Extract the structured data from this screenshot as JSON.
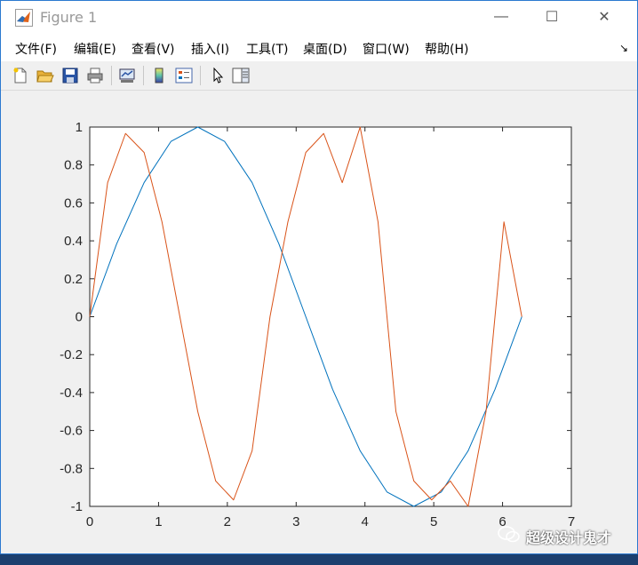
{
  "window": {
    "title": "Figure 1",
    "minimize_glyph": "—",
    "maximize_glyph": "☐",
    "close_glyph": "✕"
  },
  "menu": {
    "items": [
      "文件(F)",
      "编辑(E)",
      "查看(V)",
      "插入(I)",
      "工具(T)",
      "桌面(D)",
      "窗口(W)",
      "帮助(H)"
    ],
    "dock_glyph": "↘"
  },
  "toolbar": {
    "icons": [
      "new-figure-icon",
      "open-file-icon",
      "save-icon",
      "print-icon",
      "link-plot-icon",
      "colorbar-icon",
      "legend-icon",
      "pointer-icon",
      "property-inspector-icon"
    ]
  },
  "chart_data": {
    "type": "line",
    "title": "",
    "xlabel": "",
    "ylabel": "",
    "xlim": [
      0,
      7
    ],
    "ylim": [
      -1,
      1
    ],
    "xticks": [
      0,
      1,
      2,
      3,
      4,
      5,
      6,
      7
    ],
    "yticks": [
      -1,
      -0.8,
      -0.6,
      -0.4,
      -0.2,
      0,
      0.2,
      0.4,
      0.6,
      0.8,
      1
    ],
    "grid": false,
    "series": [
      {
        "color": "#0072bd",
        "x": [
          0,
          0.39,
          0.79,
          1.18,
          1.57,
          1.96,
          2.36,
          2.75,
          3.14,
          3.53,
          3.93,
          4.32,
          4.71,
          5.11,
          5.5,
          5.89,
          6.28
        ],
        "y": [
          0,
          0.383,
          0.707,
          0.924,
          1,
          0.924,
          0.707,
          0.383,
          0,
          -0.383,
          -0.707,
          -0.924,
          -1,
          -0.924,
          -0.707,
          -0.383,
          0
        ]
      },
      {
        "color": "#d95319",
        "x": [
          0,
          0.26,
          0.52,
          0.79,
          1.05,
          1.31,
          1.57,
          1.83,
          2.09,
          2.36,
          2.62,
          2.88,
          3.14,
          3.4,
          3.67,
          3.93,
          4.19,
          4.45,
          4.71,
          4.97,
          5.24,
          5.5,
          5.76,
          6.02,
          6.28
        ],
        "y": [
          0,
          0.707,
          0.966,
          0.866,
          0.5,
          0,
          -0.5,
          -0.866,
          -0.966,
          -0.707,
          0,
          0.5,
          0.866,
          0.966,
          0.707,
          1,
          0.5,
          -0.5,
          -0.866,
          -0.966,
          -0.866,
          -1,
          -0.5,
          0.5,
          0
        ]
      }
    ]
  },
  "watermark": {
    "text": "超级设计鬼才"
  }
}
